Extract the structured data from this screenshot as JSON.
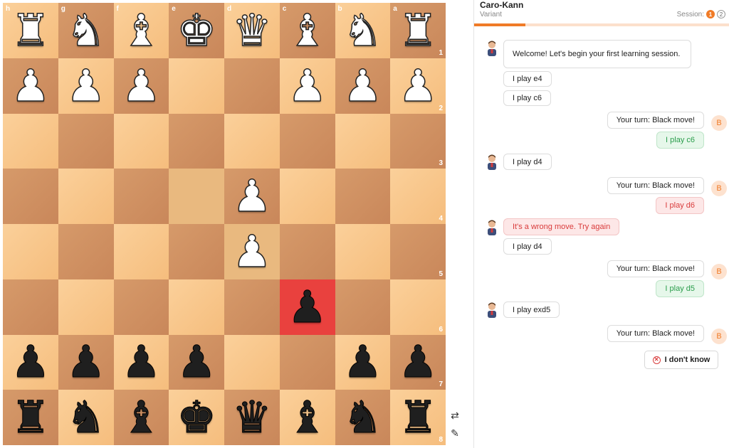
{
  "board": {
    "files": [
      "h",
      "g",
      "f",
      "e",
      "d",
      "c",
      "b",
      "a"
    ],
    "ranks": [
      "1",
      "2",
      "3",
      "4",
      "5",
      "6",
      "7",
      "8"
    ],
    "squares": [
      [
        "R",
        "N",
        "B",
        "K",
        "Q",
        "B",
        "N",
        "R"
      ],
      [
        "P",
        "P",
        "P",
        "",
        "",
        "P",
        "P",
        "P"
      ],
      [
        "",
        "",
        "",
        "",
        "",
        "",
        "",
        ""
      ],
      [
        "",
        "",
        "",
        "",
        "P",
        "",
        "",
        ""
      ],
      [
        "",
        "",
        "",
        "",
        "P",
        "",
        "",
        ""
      ],
      [
        "",
        "",
        "",
        "",
        "",
        "p",
        "",
        ""
      ],
      [
        "p",
        "p",
        "p",
        "p",
        "",
        "",
        "p",
        "p"
      ],
      [
        "r",
        "n",
        "b",
        "k",
        "q",
        "b",
        "n",
        "r"
      ]
    ],
    "highlight_move": [
      [
        3,
        3
      ],
      [
        4,
        4
      ]
    ],
    "highlight_red": [
      [
        5,
        5
      ]
    ]
  },
  "board_tools": {
    "flip_icon": "flip-board-icon",
    "pen_icon": "draw-icon"
  },
  "header": {
    "title": "Caro-Kann",
    "subtitle": "Variant",
    "session_label": "Session:",
    "session_current": "1",
    "session_next": "2",
    "progress": 0.2
  },
  "chat": {
    "welcome": "Welcome! Let's begin your first learning session.",
    "coach_1a": "I play e4",
    "coach_1b": "I play c6",
    "user_prompt_1": "Your turn: Black move!",
    "user_move_1": "I play c6",
    "coach_2": "I play d4",
    "user_prompt_2": "Your turn: Black move!",
    "user_move_2": "I play d6",
    "coach_err": "It's a wrong move. Try again",
    "coach_3": "I play d4",
    "user_prompt_3": "Your turn: Black move!",
    "user_move_3": "I play d5",
    "coach_4": "I play exd5",
    "user_prompt_4": "Your turn: Black move!",
    "user_avatar": "B",
    "idk_label": "I don't know"
  },
  "colors": {
    "accent": "#f07b27",
    "red": "#e9413e",
    "green": "#2a9d4b"
  }
}
